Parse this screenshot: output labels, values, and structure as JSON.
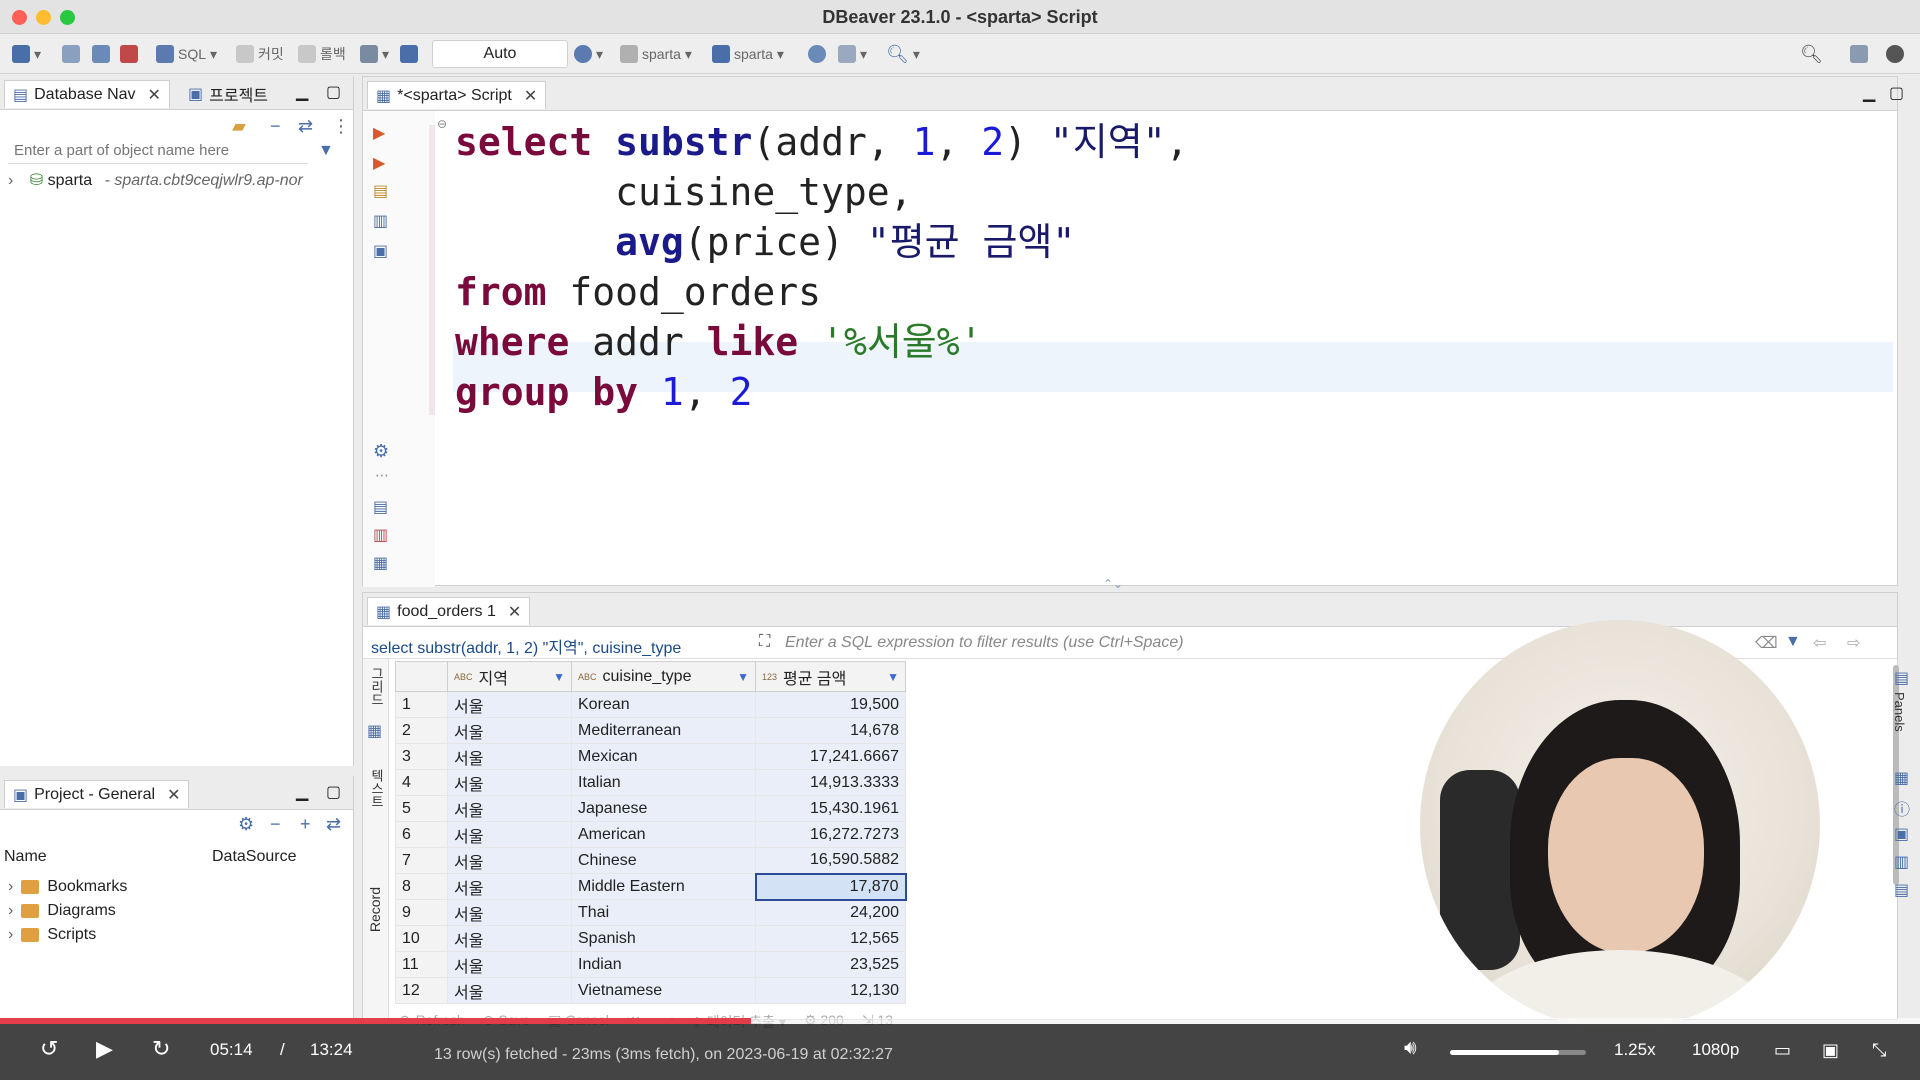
{
  "window": {
    "title": "DBeaver 23.1.0 - <sparta> Script"
  },
  "toolbar": {
    "sql_label": "SQL",
    "commit_label": "커밋",
    "rollback_label": "롤백",
    "transaction_mode": "Auto",
    "datasource_label": "sparta",
    "schema_label": "sparta"
  },
  "left_panel": {
    "tabs": [
      {
        "label": "Database Nav"
      },
      {
        "label": "프로젝트"
      }
    ],
    "filter_placeholder": "Enter a part of object name here",
    "tree": {
      "name": "sparta",
      "detail": "- sparta.cbt9ceqjwlr9.ap-nor"
    }
  },
  "project_panel": {
    "tab_label": "Project - General",
    "columns": {
      "name": "Name",
      "datasource": "DataSource"
    },
    "items": [
      {
        "label": "Bookmarks"
      },
      {
        "label": "Diagrams"
      },
      {
        "label": "Scripts"
      }
    ]
  },
  "editor": {
    "tab_label": "*<sparta> Script",
    "lines": [
      {
        "segments": [
          {
            "t": "kw",
            "v": "select"
          },
          {
            "t": "plain",
            "v": " "
          },
          {
            "t": "fn",
            "v": "substr"
          },
          {
            "t": "plain",
            "v": "(addr, "
          },
          {
            "t": "num",
            "v": "1"
          },
          {
            "t": "plain",
            "v": ", "
          },
          {
            "t": "num",
            "v": "2"
          },
          {
            "t": "plain",
            "v": ") "
          },
          {
            "t": "str",
            "v": "\"지역\""
          },
          {
            "t": "plain",
            "v": ","
          }
        ]
      },
      {
        "segments": [
          {
            "t": "plain",
            "v": "       cuisine_type,"
          }
        ]
      },
      {
        "segments": [
          {
            "t": "plain",
            "v": "       "
          },
          {
            "t": "fn",
            "v": "avg"
          },
          {
            "t": "plain",
            "v": "(price) "
          },
          {
            "t": "str",
            "v": "\"평균 금액\""
          }
        ]
      },
      {
        "segments": [
          {
            "t": "kw",
            "v": "from"
          },
          {
            "t": "plain",
            "v": " food_orders"
          }
        ]
      },
      {
        "segments": [
          {
            "t": "kw",
            "v": "where"
          },
          {
            "t": "plain",
            "v": " addr "
          },
          {
            "t": "kw",
            "v": "like"
          },
          {
            "t": "plain",
            "v": " "
          },
          {
            "t": "lit",
            "v": "'%서울%'"
          }
        ]
      },
      {
        "segments": [
          {
            "t": "kw",
            "v": "group by"
          },
          {
            "t": "plain",
            "v": " "
          },
          {
            "t": "num",
            "v": "1"
          },
          {
            "t": "plain",
            "v": ", "
          },
          {
            "t": "num",
            "v": "2"
          }
        ]
      }
    ]
  },
  "results": {
    "tab_label": "food_orders 1",
    "query_preview": "select substr(addr, 1, 2) \"지역\", cuisine_type",
    "filter_placeholder": "Enter a SQL expression to filter results (use Ctrl+Space)",
    "side_labels": {
      "grid": "그리드",
      "text": "텍스트",
      "record": "Record"
    },
    "columns": [
      "지역",
      "cuisine_type",
      "평균 금액"
    ],
    "rows": [
      {
        "n": "1",
        "region": "서울",
        "cuisine": "Korean",
        "avg": "19,500"
      },
      {
        "n": "2",
        "region": "서울",
        "cuisine": "Mediterranean",
        "avg": "14,678"
      },
      {
        "n": "3",
        "region": "서울",
        "cuisine": "Mexican",
        "avg": "17,241.6667"
      },
      {
        "n": "4",
        "region": "서울",
        "cuisine": "Italian",
        "avg": "14,913.3333"
      },
      {
        "n": "5",
        "region": "서울",
        "cuisine": "Japanese",
        "avg": "15,430.1961"
      },
      {
        "n": "6",
        "region": "서울",
        "cuisine": "American",
        "avg": "16,272.7273"
      },
      {
        "n": "7",
        "region": "서울",
        "cuisine": "Chinese",
        "avg": "16,590.5882"
      },
      {
        "n": "8",
        "region": "서울",
        "cuisine": "Middle Eastern",
        "avg": "17,870"
      },
      {
        "n": "9",
        "region": "서울",
        "cuisine": "Thai",
        "avg": "24,200"
      },
      {
        "n": "10",
        "region": "서울",
        "cuisine": "Spanish",
        "avg": "12,565"
      },
      {
        "n": "11",
        "region": "서울",
        "cuisine": "Indian",
        "avg": "23,525"
      },
      {
        "n": "12",
        "region": "서울",
        "cuisine": "Vietnamese",
        "avg": "12,130"
      }
    ],
    "selected_row": 8,
    "bottom_toolbar": {
      "refresh": "Refresh",
      "save": "Save",
      "cancel": "Cancel",
      "export": "데이터 추출",
      "fetch_size": "200",
      "row_count": "13"
    },
    "status": "13 row(s) fetched - 23ms (3ms fetch), on 2023-06-19 at 02:32:27"
  },
  "right_strip": {
    "panels_label": "Panels"
  },
  "video": {
    "current_time": "05:14",
    "separator": "/",
    "duration": "13:24",
    "speed": "1.25x",
    "quality": "1080p",
    "progress": 0.391,
    "volume": 0.8,
    "colors": {
      "progress": "#e53c4a"
    }
  }
}
